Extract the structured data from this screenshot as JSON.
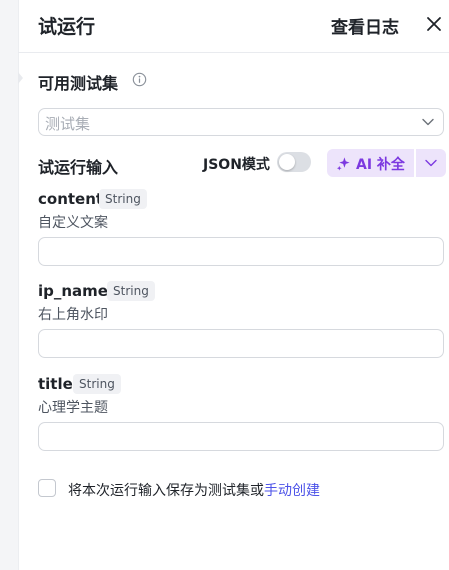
{
  "header": {
    "title": "试运行",
    "log_link": "查看日志"
  },
  "test_set": {
    "label": "可用测试集",
    "placeholder": "测试集"
  },
  "run_input": {
    "label": "试运行输入",
    "json_mode_label": "JSON模式",
    "json_mode_on": false,
    "ai_fill_label": "AI 补全",
    "accent_color": "#7c39e0"
  },
  "fields": [
    {
      "name": "content",
      "type": "String",
      "description": "自定义文案",
      "value": ""
    },
    {
      "name": "ip_name",
      "type": "String",
      "description": "右上角水印",
      "value": ""
    },
    {
      "name": "title",
      "type": "String",
      "description": "心理学主题",
      "value": ""
    }
  ],
  "footer": {
    "save_text": "将本次运行输入保存为测试集或",
    "manual_link": "手动创建",
    "link_color": "#4d53e8"
  }
}
